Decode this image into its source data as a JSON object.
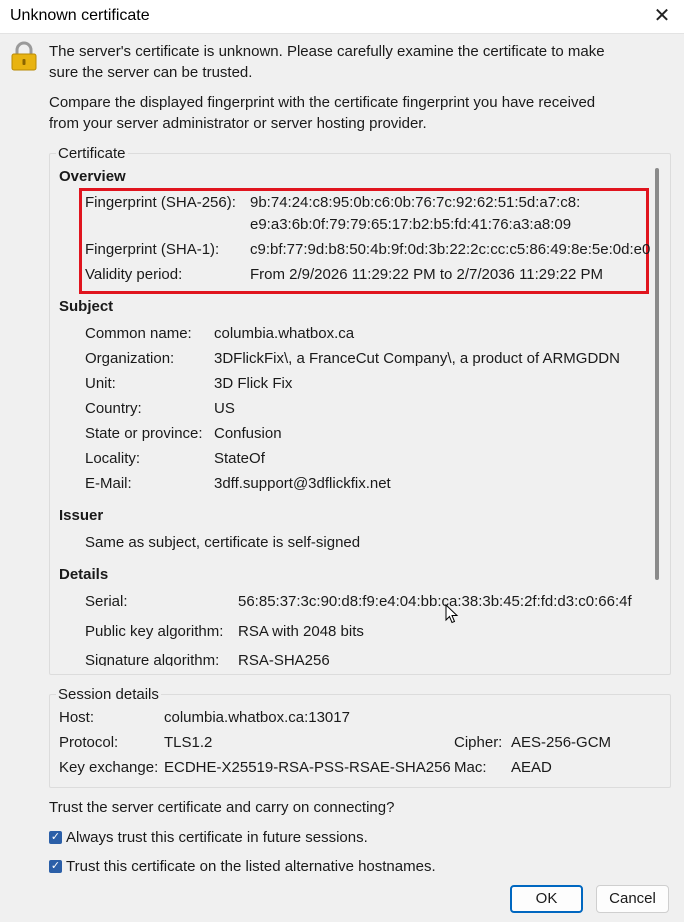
{
  "window": {
    "title": "Unknown certificate"
  },
  "intro": {
    "line1": "The server's certificate is unknown. Please carefully examine the certificate to make",
    "line2": "sure the server can be trusted.",
    "line3": "Compare the displayed fingerprint with the certificate fingerprint you have received",
    "line4": "from your server administrator or server hosting provider."
  },
  "certificate": {
    "group_label": "Certificate",
    "overview": {
      "heading": "Overview",
      "sha256_label": "Fingerprint (SHA-256):",
      "sha256_line1": "9b:74:24:c8:95:0b:c6:0b:76:7c:92:62:51:5d:a7:c8:",
      "sha256_line2": "e9:a3:6b:0f:79:79:65:17:b2:b5:fd:41:76:a3:a8:09",
      "sha1_label": "Fingerprint (SHA-1):",
      "sha1_value": "c9:bf:77:9d:b8:50:4b:9f:0d:3b:22:2c:cc:c5:86:49:8e:5e:0d:e0",
      "validity_label": "Validity period:",
      "validity_value": "From 2/9/2026 11:29:22 PM to 2/7/2036 11:29:22 PM"
    },
    "subject": {
      "heading": "Subject",
      "rows": [
        {
          "label": "Common name:",
          "value": "columbia.whatbox.ca"
        },
        {
          "label": "Organization:",
          "value": "3DFlickFix\\, a FranceCut Company\\, a product of ARMGDDN"
        },
        {
          "label": "Unit:",
          "value": "3D Flick Fix"
        },
        {
          "label": "Country:",
          "value": "US"
        },
        {
          "label": "State or province:",
          "value": "Confusion"
        },
        {
          "label": "Locality:",
          "value": "StateOf"
        },
        {
          "label": "E-Mail:",
          "value": "3dff.support@3dflickfix.net"
        }
      ]
    },
    "issuer": {
      "heading": "Issuer",
      "text": "Same as subject, certificate is self-signed"
    },
    "details": {
      "heading": "Details",
      "serial_label": "Serial:",
      "serial_value": "56:85:37:3c:90:d8:f9:e4:04:bb:ca:38:3b:45:2f:fd:d3:c0:66:4f",
      "pubkey_label": "Public key algorithm:",
      "pubkey_value": "RSA with 2048 bits",
      "sig_label": "Signature algorithm:",
      "sig_value": "RSA-SHA256"
    }
  },
  "session": {
    "group_label": "Session details",
    "host_label": "Host:",
    "host_value": "columbia.whatbox.ca:13017",
    "protocol_label": "Protocol:",
    "protocol_value": "TLS1.2",
    "cipher_label": "Cipher:",
    "cipher_value": "AES-256-GCM",
    "kex_label": "Key exchange:",
    "kex_value": "ECDHE-X25519-RSA-PSS-RSAE-SHA256",
    "mac_label": "Mac:",
    "mac_value": "AEAD"
  },
  "trust": {
    "question": "Trust the server certificate and carry on connecting?",
    "always_trust": "Always trust this certificate in future sessions.",
    "alt_hostnames": "Trust this certificate on the listed alternative hostnames."
  },
  "buttons": {
    "ok": "OK",
    "cancel": "Cancel"
  },
  "colors": {
    "highlight_box": "#e0141e",
    "accent": "#0067c0",
    "checkbox": "#2b5fa8",
    "lock_body": "#e8b311"
  }
}
